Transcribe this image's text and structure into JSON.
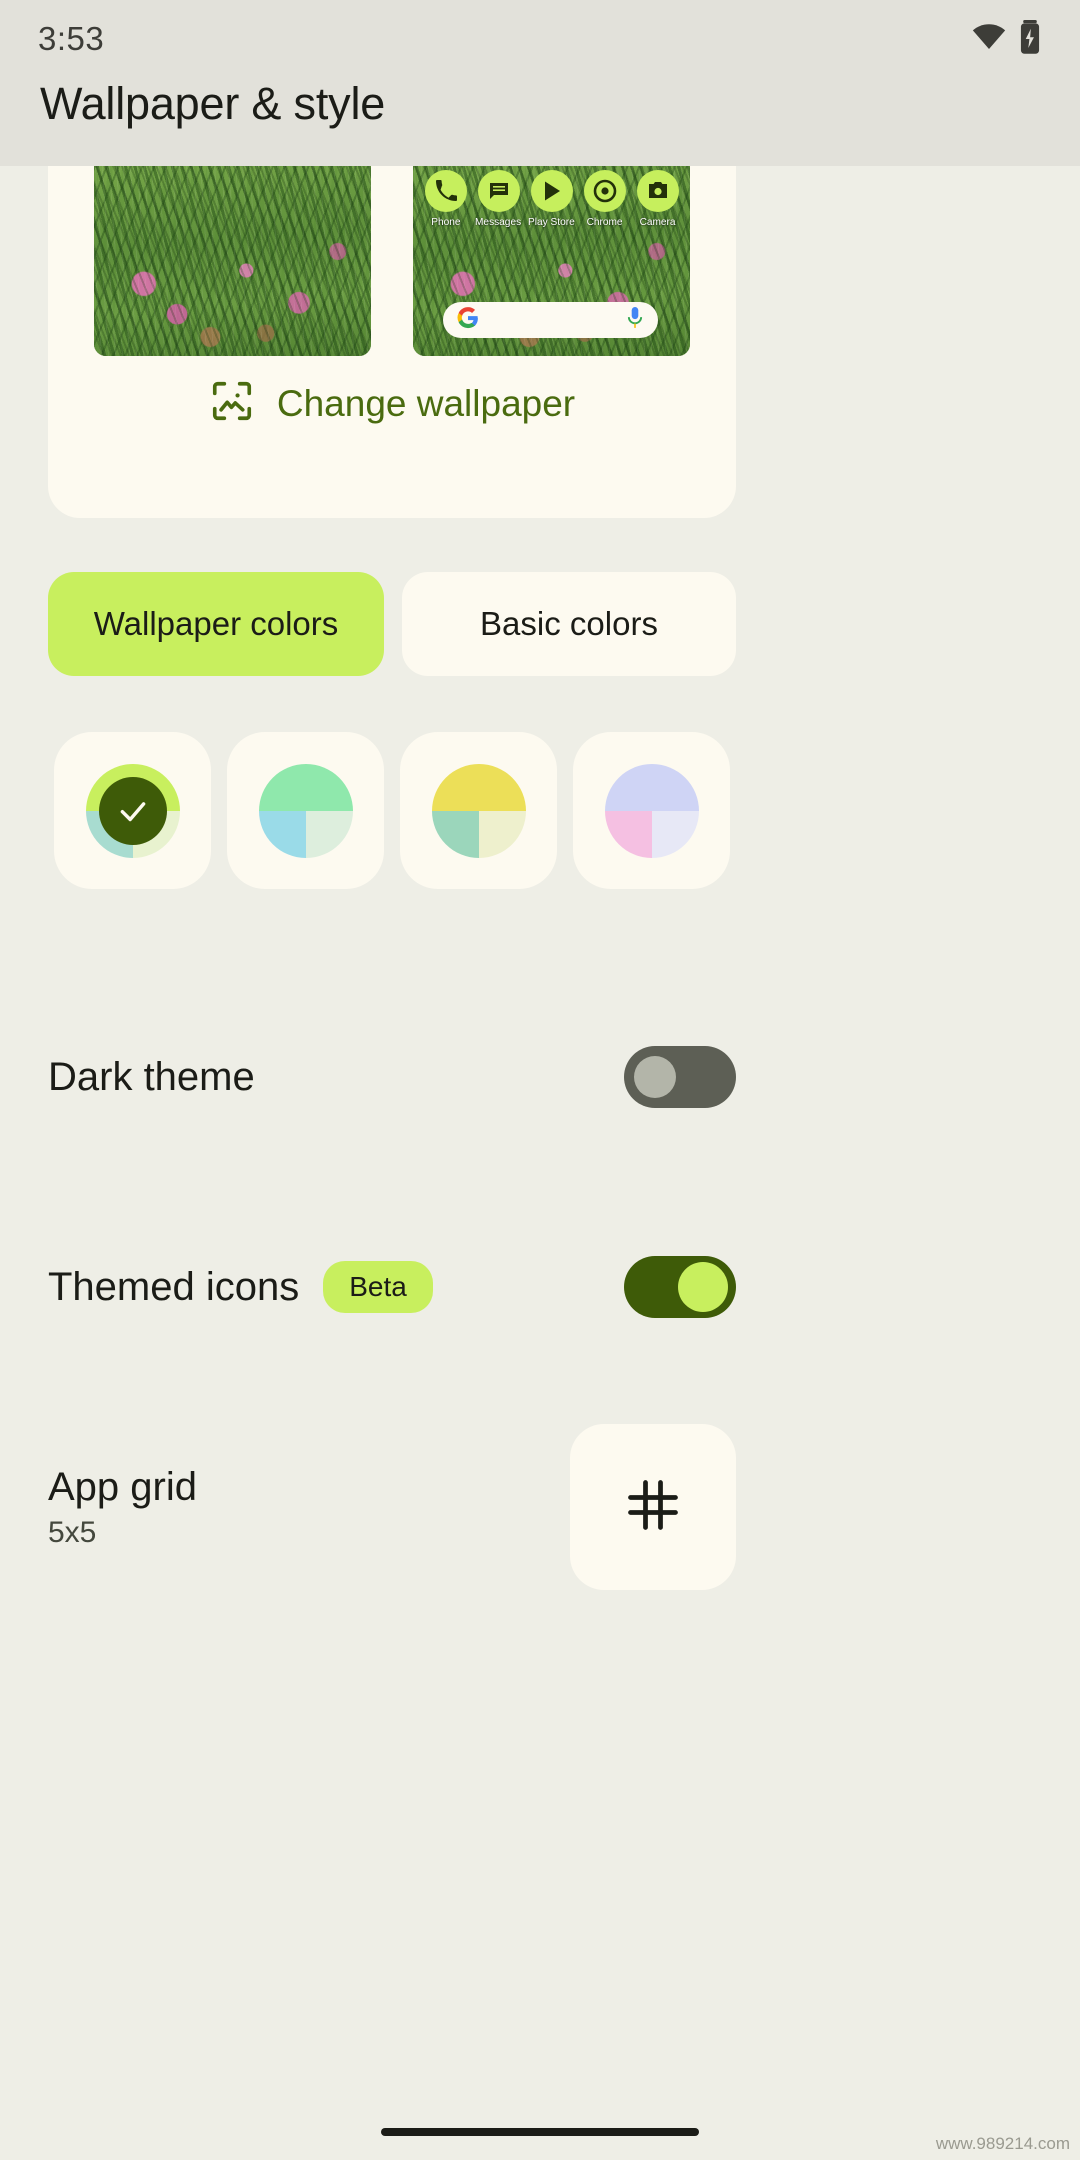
{
  "statusbar": {
    "time": "3:53",
    "wifi_icon": "wifi-icon",
    "battery_icon": "battery-charging-icon"
  },
  "header": {
    "title": "Wallpaper & style"
  },
  "preview": {
    "lock_preview_name": "lock-screen-preview",
    "home_preview_name": "home-screen-preview",
    "apps": [
      {
        "label": "Phone",
        "icon": "phone-icon"
      },
      {
        "label": "Messages",
        "icon": "messages-icon"
      },
      {
        "label": "Play Store",
        "icon": "play-store-icon"
      },
      {
        "label": "Chrome",
        "icon": "chrome-icon"
      },
      {
        "label": "Camera",
        "icon": "camera-icon"
      }
    ],
    "search": {
      "logo": "google-g-icon",
      "mic": "microphone-icon"
    },
    "change_wallpaper": {
      "label": "Change wallpaper",
      "icon": "image-icon"
    }
  },
  "tabs": [
    {
      "label": "Wallpaper colors",
      "selected": true
    },
    {
      "label": "Basic colors",
      "selected": false
    }
  ],
  "color_swatches": [
    {
      "name": "swatch-1",
      "selected": true,
      "top": "#c8ef5e",
      "bottom_left": "#a8dcd0",
      "bottom_right": "#e8f2cf",
      "overlay": "#3e5b08",
      "check": "check-icon"
    },
    {
      "name": "swatch-2",
      "selected": false,
      "top": "#8fe8ac",
      "bottom_left": "#9adbe8",
      "bottom_right": "#ddeedd"
    },
    {
      "name": "swatch-3",
      "selected": false,
      "top": "#ecdf58",
      "bottom_left": "#9bd6bb",
      "bottom_right": "#eef0cd"
    },
    {
      "name": "swatch-4",
      "selected": false,
      "top": "#cfd4f5",
      "bottom_left": "#f5c0e2",
      "bottom_right": "#e7e8f6"
    }
  ],
  "settings": {
    "dark_theme": {
      "title": "Dark theme",
      "enabled": false
    },
    "themed_icons": {
      "title": "Themed icons",
      "badge": "Beta",
      "enabled": true
    },
    "app_grid": {
      "title": "App grid",
      "value": "5x5",
      "icon": "grid-icon"
    }
  },
  "navbar": {
    "handle": "home-gesture-handle"
  },
  "watermark": "www.989214.com",
  "colors": {
    "accent": "#c8ef5e",
    "accent_dark": "#3e5b08",
    "link": "#4a6b0f",
    "surface": "#fdfaf0",
    "background": "#eeeee6",
    "statusbar": "#e2e1da"
  }
}
